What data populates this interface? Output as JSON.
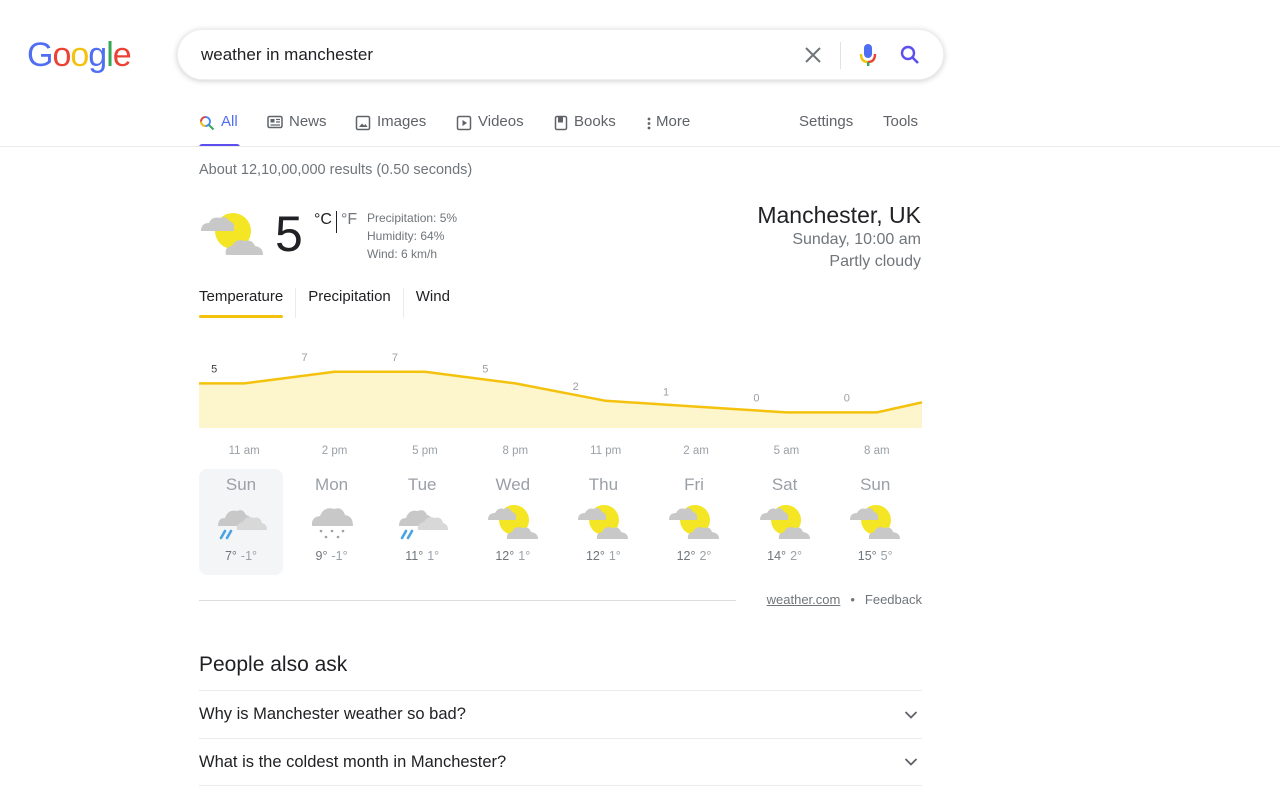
{
  "logo": {
    "letters": [
      "G",
      "o",
      "o",
      "g",
      "l",
      "e"
    ]
  },
  "search": {
    "query": "weather in manchester",
    "clear_icon": "close-icon",
    "mic_icon": "mic-icon",
    "search_icon": "search-icon"
  },
  "tabs": [
    {
      "label": "All",
      "icon": "search-icon",
      "active": true
    },
    {
      "label": "News",
      "icon": "newspaper-icon"
    },
    {
      "label": "Images",
      "icon": "image-icon"
    },
    {
      "label": "Videos",
      "icon": "play-icon"
    },
    {
      "label": "Books",
      "icon": "book-icon"
    },
    {
      "label": "More",
      "icon": "more-vertical-icon"
    }
  ],
  "tools": {
    "settings": "Settings",
    "tools": "Tools"
  },
  "result_stats": "About 12,10,00,000 results (0.50 seconds)",
  "weather": {
    "current_temp": "5",
    "unit_c": "°C",
    "unit_f": "°F",
    "precipitation": "Precipitation: 5%",
    "humidity": "Humidity: 64%",
    "wind": "Wind: 6 km/h",
    "location": "Manchester, UK",
    "datetime": "Sunday, 10:00 am",
    "condition": "Partly cloudy",
    "tabs": [
      "Temperature",
      "Precipitation",
      "Wind"
    ],
    "active_tab": "Temperature",
    "accent_color": "#f4c20d",
    "days": [
      {
        "name": "Sun",
        "icon": "rain-cloudy",
        "hi": "7°",
        "lo": "-1°",
        "selected": true
      },
      {
        "name": "Mon",
        "icon": "snow",
        "hi": "9°",
        "lo": "-1°"
      },
      {
        "name": "Tue",
        "icon": "rain-cloudy",
        "hi": "11°",
        "lo": "1°"
      },
      {
        "name": "Wed",
        "icon": "partly-cloudy",
        "hi": "12°",
        "lo": "1°"
      },
      {
        "name": "Thu",
        "icon": "partly-cloudy",
        "hi": "12°",
        "lo": "1°"
      },
      {
        "name": "Fri",
        "icon": "partly-cloudy",
        "hi": "12°",
        "lo": "2°"
      },
      {
        "name": "Sat",
        "icon": "partly-cloudy",
        "hi": "14°",
        "lo": "2°"
      },
      {
        "name": "Sun",
        "icon": "partly-cloudy",
        "hi": "15°",
        "lo": "5°"
      }
    ],
    "source": "weather.com",
    "feedback": "Feedback"
  },
  "chart_data": {
    "type": "area",
    "title": "",
    "xlabel": "",
    "ylabel": "",
    "x": [
      "11 am",
      "2 pm",
      "5 pm",
      "8 pm",
      "11 pm",
      "2 am",
      "5 am",
      "8 am"
    ],
    "values": [
      5,
      7,
      7,
      5,
      2,
      1,
      0,
      0
    ],
    "labels": [
      "5",
      "7",
      "7",
      "5",
      "2",
      "1",
      "0",
      "0"
    ],
    "ylim": [
      -2,
      8
    ],
    "grid": false,
    "legend": "none",
    "color": "#f4c20d",
    "fill": "#fdf5cc"
  },
  "people_also_ask": {
    "title": "People also ask",
    "questions": [
      "Why is Manchester weather so bad?",
      "What is the coldest month in Manchester?"
    ]
  }
}
